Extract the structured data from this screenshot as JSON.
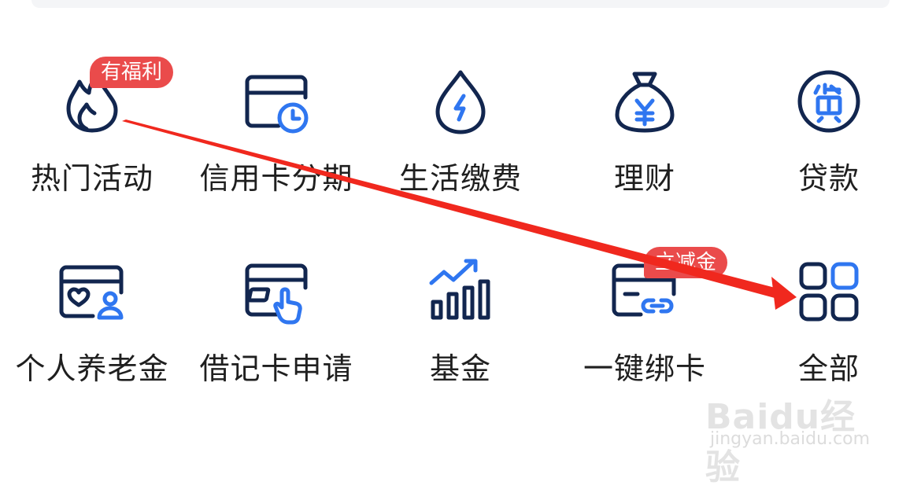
{
  "grid": {
    "items": [
      {
        "label": "热门活动",
        "icon": "flame-icon",
        "badge": "有福利"
      },
      {
        "label": "信用卡分期",
        "icon": "card-clock-icon"
      },
      {
        "label": "生活缴费",
        "icon": "water-bolt-icon"
      },
      {
        "label": "理财",
        "icon": "money-bag-icon"
      },
      {
        "label": "贷款",
        "icon": "loan-icon"
      },
      {
        "label": "个人养老金",
        "icon": "card-heart-user-icon"
      },
      {
        "label": "借记卡申请",
        "icon": "card-tap-icon"
      },
      {
        "label": "基金",
        "icon": "bar-chart-trend-icon"
      },
      {
        "label": "一键绑卡",
        "icon": "card-link-icon",
        "badge": "立减金"
      },
      {
        "label": "全部",
        "icon": "grid-icon"
      }
    ]
  },
  "colors": {
    "icon_stroke": "#12264f",
    "icon_accent": "#2f76f0",
    "badge_bg": "#ea4b4b",
    "annotation_arrow": "#f0281e"
  },
  "watermark": {
    "logo": "Baidu经验",
    "url": "jingyan.baidu.com"
  }
}
